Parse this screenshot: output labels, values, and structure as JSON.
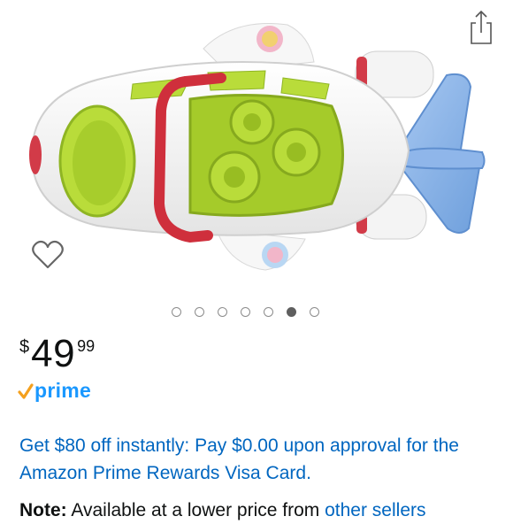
{
  "share_icon": "share-icon",
  "wishlist_icon": "heart-outline-icon",
  "carousel": {
    "count": 7,
    "active_index": 5
  },
  "price": {
    "symbol": "$",
    "whole": "49",
    "fraction": "99"
  },
  "prime": {
    "check_icon": "prime-check-icon",
    "label": "prime"
  },
  "promo": {
    "text": "Get $80 off instantly: Pay $0.00 upon approval for the Amazon Prime Rewards Visa Card."
  },
  "note": {
    "label": "Note:",
    "text": "Available at a lower price from ",
    "link": "other sellers"
  },
  "colors": {
    "link": "#0066c0",
    "prime": "#1a98ff",
    "prime_check": "#f4a01d"
  }
}
